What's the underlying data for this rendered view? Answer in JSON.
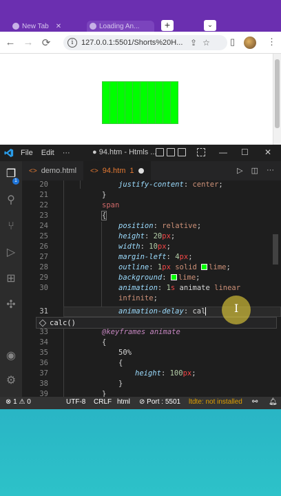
{
  "browser": {
    "tabs": [
      {
        "label": "New Tab"
      },
      {
        "label": "Loading An..."
      }
    ],
    "new_tab": "+",
    "tab_search": "⌄",
    "url": "127.0.0.1:5501/Shorts%20H...",
    "nav": {
      "back": "←",
      "forward": "→",
      "reload": "⟳",
      "info": "i"
    },
    "actions": {
      "share": "⇪",
      "bookmark": "☆",
      "sidepanel": "▯",
      "menu": "⋮"
    }
  },
  "preview": {
    "bar_count": 10,
    "bar_color": "#00ff00"
  },
  "vscode": {
    "menus": [
      "File",
      "Edit",
      "···"
    ],
    "title": "● 94.htm - Htmls ...",
    "window_controls": {
      "minimize": "—",
      "maximize": "☐",
      "close": "✕"
    },
    "tabs": [
      {
        "label": "demo.html",
        "icon": "<>"
      },
      {
        "label": "94.htm",
        "icon": "<>",
        "problems": "1"
      }
    ],
    "activity_badge": "1",
    "editor_lines": [
      {
        "n": "20",
        "text": "justify-content: center;"
      },
      {
        "n": "21",
        "text": "}"
      },
      {
        "n": "22",
        "text": "span"
      },
      {
        "n": "23",
        "text": "{"
      },
      {
        "n": "24",
        "text": "position: relative;"
      },
      {
        "n": "25",
        "text": "height: 20px;"
      },
      {
        "n": "26",
        "text": "width: 10px;"
      },
      {
        "n": "27",
        "text": "margin-left: 4px;"
      },
      {
        "n": "28",
        "text": "outline: 1px solid lime;"
      },
      {
        "n": "29",
        "text": "background: lime;"
      },
      {
        "n": "30",
        "text": "animation: 1s animate linear infinite;"
      },
      {
        "n": "31",
        "text": "animation-delay: cal"
      },
      {
        "n": "33",
        "text": "@keyframes animate"
      },
      {
        "n": "34",
        "text": "{"
      },
      {
        "n": "35",
        "text": "50%"
      },
      {
        "n": "36",
        "text": "{"
      },
      {
        "n": "37",
        "text": "height: 100px;"
      },
      {
        "n": "38",
        "text": "}"
      },
      {
        "n": "39",
        "text": "}"
      }
    ],
    "suggestion": "calc()",
    "status": {
      "problems": "⊗ 1 ⚠ 0",
      "encoding": "UTF-8",
      "eol": "CRLF",
      "language": "html",
      "port": "⊘ Port : 5501",
      "extension": "ltdte: not installed"
    }
  }
}
